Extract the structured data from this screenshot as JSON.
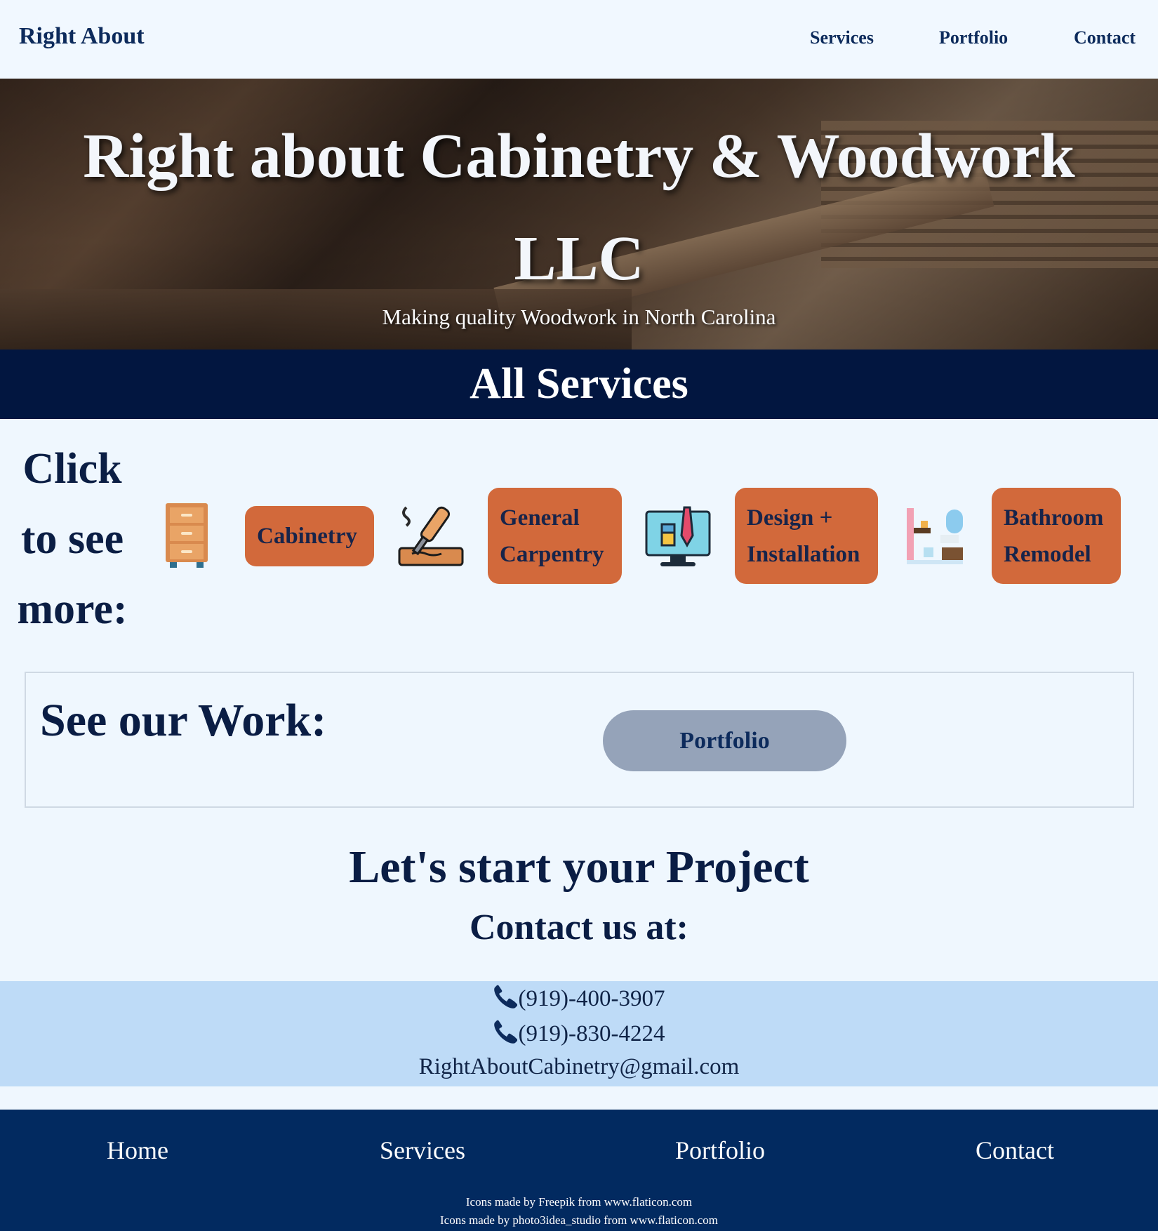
{
  "nav": {
    "brand": "Right About",
    "links": [
      "Services",
      "Portfolio",
      "Contact"
    ]
  },
  "hero": {
    "title_line1": "Right about Cabinetry & Woodwork",
    "title_line2": "LLC",
    "subtitle": "Making quality Woodwork in North Carolina"
  },
  "services": {
    "banner": "All Services",
    "click_prompt": [
      "Click",
      "to see",
      "more:"
    ],
    "items": [
      {
        "icon": "cabinet-drawers-icon",
        "label_lines": [
          "Cabinetry"
        ]
      },
      {
        "icon": "wood-chisel-icon",
        "label_lines": [
          "General",
          "Carpentry"
        ]
      },
      {
        "icon": "design-monitor-icon",
        "label_lines": [
          "Design +",
          "Installation"
        ]
      },
      {
        "icon": "bathroom-icon",
        "label_lines": [
          "Bathroom",
          "Remodel"
        ]
      }
    ]
  },
  "work": {
    "title": "See our Work:",
    "button": "Portfolio"
  },
  "cta": {
    "title": "Let's start your Project",
    "subtitle": "Contact us at:"
  },
  "contact": {
    "phones": [
      "(919)-400-3907",
      "(919)-830-4224"
    ],
    "email": "RightAboutCabinetry@gmail.com"
  },
  "footer": {
    "links": [
      "Home",
      "Services",
      "Portfolio",
      "Contact"
    ],
    "credits": [
      "Icons made by Freepik from www.flaticon.com",
      "Icons made by photo3idea_studio from www.flaticon.com"
    ]
  },
  "colors": {
    "navy": "#021640",
    "accent": "#d2693b",
    "footer": "#022a60",
    "contact_band": "#bedbf7"
  }
}
